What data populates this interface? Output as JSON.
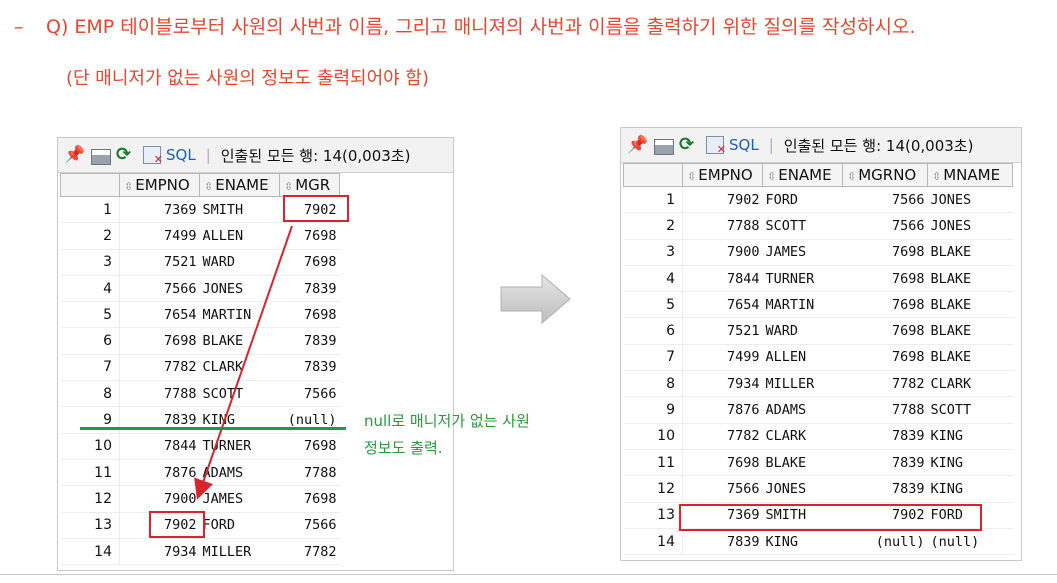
{
  "question": {
    "dash": "–",
    "text": "Q) EMP 테이블로부터 사원의 사번과 이름, 그리고 매니져의 사번과 이름을 출력하기 위한 질의를 작성하시오.",
    "note": "(단 매니저가 없는 사원의 정보도 출력되어야 함)"
  },
  "left_panel": {
    "toolbar": {
      "sql_label": "SQL",
      "separator": "|",
      "status": "인출된 모든 행: 14(0,003초)"
    },
    "columns": [
      "EMPNO",
      "ENAME",
      "MGR"
    ],
    "rows": [
      {
        "n": "1",
        "empno": "7369",
        "ename": "SMITH",
        "mgr": "7902"
      },
      {
        "n": "2",
        "empno": "7499",
        "ename": "ALLEN",
        "mgr": "7698"
      },
      {
        "n": "3",
        "empno": "7521",
        "ename": "WARD",
        "mgr": "7698"
      },
      {
        "n": "4",
        "empno": "7566",
        "ename": "JONES",
        "mgr": "7839"
      },
      {
        "n": "5",
        "empno": "7654",
        "ename": "MARTIN",
        "mgr": "7698"
      },
      {
        "n": "6",
        "empno": "7698",
        "ename": "BLAKE",
        "mgr": "7839"
      },
      {
        "n": "7",
        "empno": "7782",
        "ename": "CLARK",
        "mgr": "7839"
      },
      {
        "n": "8",
        "empno": "7788",
        "ename": "SCOTT",
        "mgr": "7566"
      },
      {
        "n": "9",
        "empno": "7839",
        "ename": "KING",
        "mgr": "(null)"
      },
      {
        "n": "10",
        "empno": "7844",
        "ename": "TURNER",
        "mgr": "7698"
      },
      {
        "n": "11",
        "empno": "7876",
        "ename": "ADAMS",
        "mgr": "7788"
      },
      {
        "n": "12",
        "empno": "7900",
        "ename": "JAMES",
        "mgr": "7698"
      },
      {
        "n": "13",
        "empno": "7902",
        "ename": "FORD",
        "mgr": "7566"
      },
      {
        "n": "14",
        "empno": "7934",
        "ename": "MILLER",
        "mgr": "7782"
      }
    ]
  },
  "annotation": {
    "null_note_line1": "null로 매니저가 없는 사원",
    "null_note_line2": "정보도 출력."
  },
  "right_panel": {
    "toolbar": {
      "sql_label": "SQL",
      "separator": "|",
      "status": "인출된 모든 행: 14(0,003초)"
    },
    "columns": [
      "EMPNO",
      "ENAME",
      "MGRNO",
      "MNAME"
    ],
    "rows": [
      {
        "n": "1",
        "empno": "7902",
        "ename": "FORD",
        "mgrno": "7566",
        "mname": "JONES"
      },
      {
        "n": "2",
        "empno": "7788",
        "ename": "SCOTT",
        "mgrno": "7566",
        "mname": "JONES"
      },
      {
        "n": "3",
        "empno": "7900",
        "ename": "JAMES",
        "mgrno": "7698",
        "mname": "BLAKE"
      },
      {
        "n": "4",
        "empno": "7844",
        "ename": "TURNER",
        "mgrno": "7698",
        "mname": "BLAKE"
      },
      {
        "n": "5",
        "empno": "7654",
        "ename": "MARTIN",
        "mgrno": "7698",
        "mname": "BLAKE"
      },
      {
        "n": "6",
        "empno": "7521",
        "ename": "WARD",
        "mgrno": "7698",
        "mname": "BLAKE"
      },
      {
        "n": "7",
        "empno": "7499",
        "ename": "ALLEN",
        "mgrno": "7698",
        "mname": "BLAKE"
      },
      {
        "n": "8",
        "empno": "7934",
        "ename": "MILLER",
        "mgrno": "7782",
        "mname": "CLARK"
      },
      {
        "n": "9",
        "empno": "7876",
        "ename": "ADAMS",
        "mgrno": "7788",
        "mname": "SCOTT"
      },
      {
        "n": "10",
        "empno": "7782",
        "ename": "CLARK",
        "mgrno": "7839",
        "mname": "KING"
      },
      {
        "n": "11",
        "empno": "7698",
        "ename": "BLAKE",
        "mgrno": "7839",
        "mname": "KING"
      },
      {
        "n": "12",
        "empno": "7566",
        "ename": "JONES",
        "mgrno": "7839",
        "mname": "KING"
      },
      {
        "n": "13",
        "empno": "7369",
        "ename": "SMITH",
        "mgrno": "7902",
        "mname": "FORD"
      },
      {
        "n": "14",
        "empno": "7839",
        "ename": "KING",
        "mgrno": "(null)",
        "mname": "(null)"
      }
    ]
  },
  "colors": {
    "accent_red": "#d9232d",
    "question_text": "#e8462e",
    "annotation_green": "#1c9c3c"
  },
  "icons": [
    "pin-icon",
    "print-icon",
    "refresh-icon",
    "delete-icon",
    "sort-icon",
    "arrow-right-icon"
  ]
}
